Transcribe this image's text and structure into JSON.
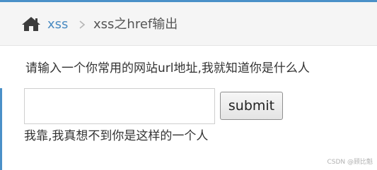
{
  "breadcrumb": {
    "home_icon": "home-icon",
    "link_label": "xss",
    "separator_icon": "chevron-right-icon",
    "current_label": "xss之href输出"
  },
  "form": {
    "prompt": "请输入一个你常用的网站url地址,我就知道你是什么人",
    "input_value": "",
    "input_placeholder": "",
    "submit_label": "submit"
  },
  "result_text": "我靠,我真想不到你是这样的一个人",
  "watermark": "CSDN @顾比魁",
  "colors": {
    "accent": "#4a90c8",
    "link": "#4a8bc2",
    "breadcrumb_bg": "#f5f5f5"
  }
}
